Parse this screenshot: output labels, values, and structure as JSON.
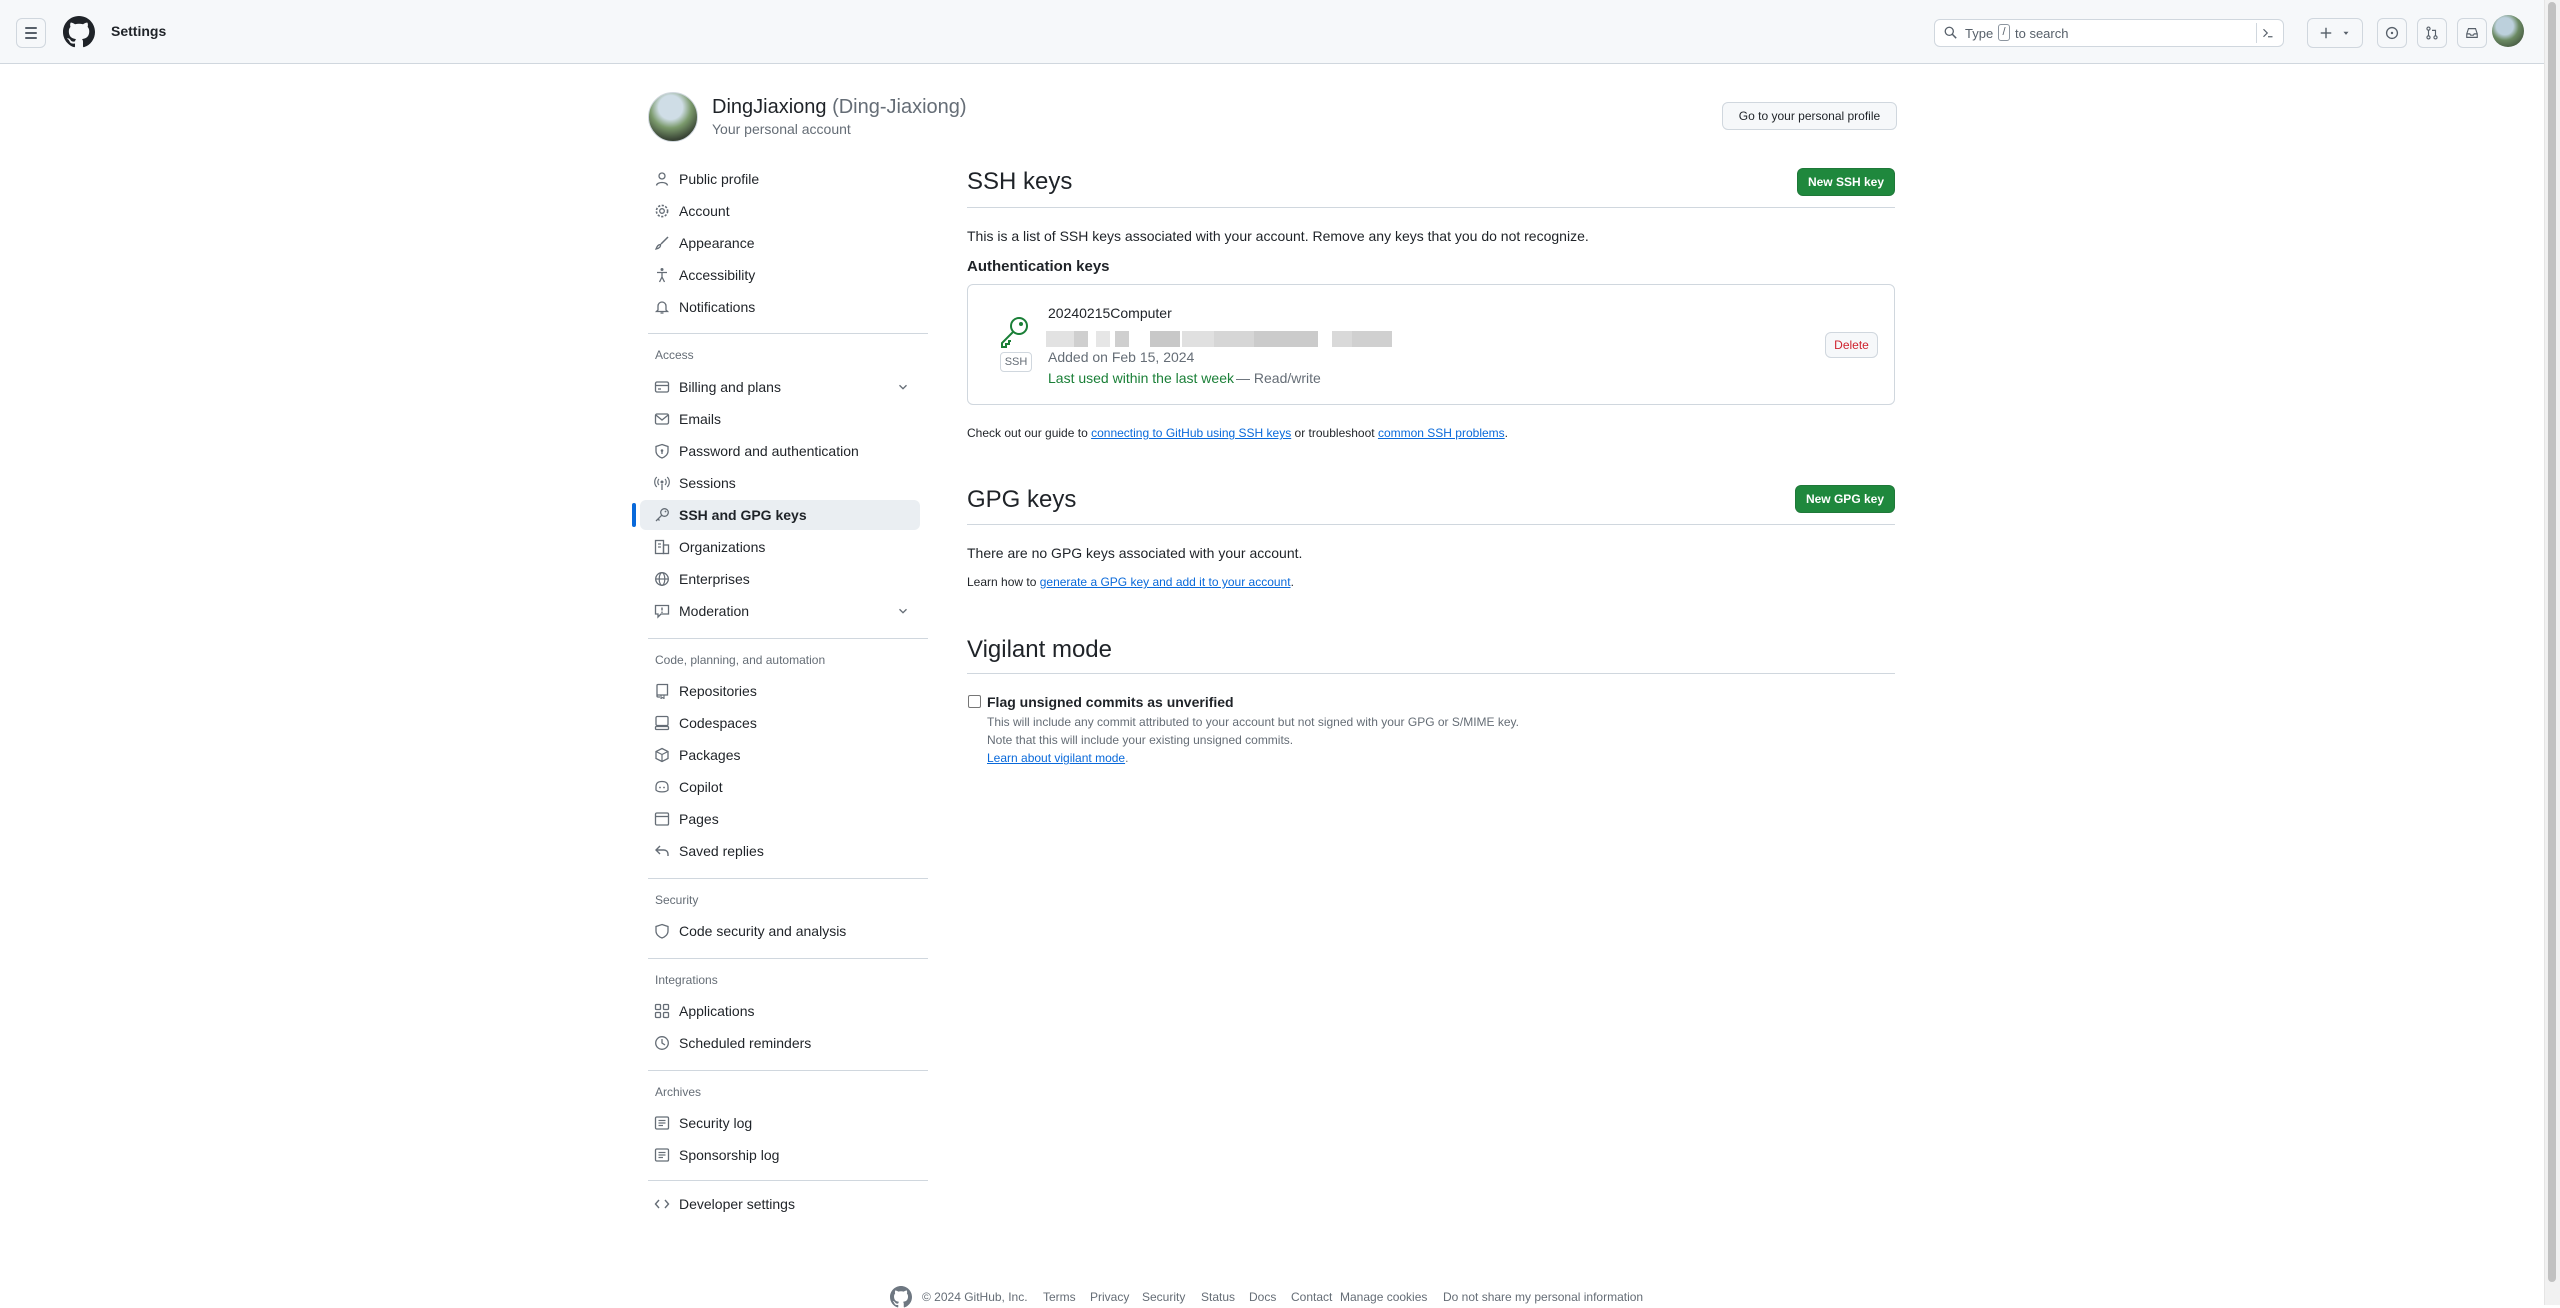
{
  "header": {
    "context": "Settings",
    "search": {
      "prefix": "Type",
      "key": "/",
      "suffix": "to search"
    },
    "icons": [
      "menu-icon",
      "github-mark-icon",
      "search-icon",
      "command-palette-icon",
      "plus-icon",
      "triangle-down-icon",
      "issue-opened-icon",
      "git-pull-request-icon",
      "inbox-icon",
      "avatar"
    ]
  },
  "profile": {
    "name": "DingJiaxiong",
    "login": "(Ding-Jiaxiong)",
    "subtitle": "Your personal account",
    "go_to_profile": "Go to your personal profile"
  },
  "sidebar": {
    "items": [
      {
        "label": "Public profile",
        "icon": "person-icon"
      },
      {
        "label": "Account",
        "icon": "gear-icon"
      },
      {
        "label": "Appearance",
        "icon": "paintbrush-icon"
      },
      {
        "label": "Accessibility",
        "icon": "accessibility-icon"
      },
      {
        "label": "Notifications",
        "icon": "bell-icon"
      }
    ],
    "headings": {
      "access": "Access",
      "code": "Code, planning, and automation",
      "security": "Security",
      "integrations": "Integrations",
      "archives": "Archives"
    },
    "access_items": [
      {
        "label": "Billing and plans",
        "icon": "credit-card-icon",
        "expandable": true
      },
      {
        "label": "Emails",
        "icon": "mail-icon"
      },
      {
        "label": "Password and authentication",
        "icon": "shield-lock-icon"
      },
      {
        "label": "Sessions",
        "icon": "broadcast-icon"
      },
      {
        "label": "SSH and GPG keys",
        "icon": "key-icon",
        "active": true
      },
      {
        "label": "Organizations",
        "icon": "organization-icon"
      },
      {
        "label": "Enterprises",
        "icon": "globe-icon"
      },
      {
        "label": "Moderation",
        "icon": "report-icon",
        "expandable": true
      }
    ],
    "code_items": [
      {
        "label": "Repositories",
        "icon": "repo-icon"
      },
      {
        "label": "Codespaces",
        "icon": "codespaces-icon"
      },
      {
        "label": "Packages",
        "icon": "package-icon"
      },
      {
        "label": "Copilot",
        "icon": "copilot-icon"
      },
      {
        "label": "Pages",
        "icon": "browser-icon"
      },
      {
        "label": "Saved replies",
        "icon": "reply-icon"
      }
    ],
    "security_items": [
      {
        "label": "Code security and analysis",
        "icon": "codescan-icon"
      }
    ],
    "integration_items": [
      {
        "label": "Applications",
        "icon": "apps-icon"
      },
      {
        "label": "Scheduled reminders",
        "icon": "clock-icon"
      }
    ],
    "archive_items": [
      {
        "label": "Security log",
        "icon": "log-icon"
      },
      {
        "label": "Sponsorship log",
        "icon": "log-icon"
      }
    ],
    "developer": {
      "label": "Developer settings",
      "icon": "code-icon"
    }
  },
  "ssh": {
    "title": "SSH keys",
    "new_button": "New SSH key",
    "description": "This is a list of SSH keys associated with your account. Remove any keys that you do not recognize.",
    "auth_heading": "Authentication keys",
    "key": {
      "name": "20240215Computer",
      "badge": "SSH",
      "added": "Added on Feb 15, 2024",
      "last_used": "Last used within the last week",
      "access": "— Read/write",
      "delete": "Delete"
    },
    "guide": {
      "pre": "Check out our guide to",
      "link1": "connecting to GitHub using SSH keys",
      "mid": "or troubleshoot",
      "link2": "common SSH problems",
      "post": "."
    }
  },
  "gpg": {
    "title": "GPG keys",
    "new_button": "New GPG key",
    "empty": "There are no GPG keys associated with your account.",
    "learn_pre": "Learn how to",
    "learn_link": "generate a GPG key and add it to your account",
    "learn_post": "."
  },
  "vigilant": {
    "title": "Vigilant mode",
    "checkbox_label": "Flag unsigned commits as unverified",
    "checked": false,
    "line1": "This will include any commit attributed to your account but not signed with your GPG or S/MIME key.",
    "line2": "Note that this will include your existing unsigned commits.",
    "link": "Learn about vigilant mode",
    "link_post": "."
  },
  "footer": {
    "copyright": "© 2024 GitHub, Inc.",
    "links": [
      "Terms",
      "Privacy",
      "Security",
      "Status",
      "Docs",
      "Contact",
      "Manage cookies",
      "Do not share my personal information"
    ]
  },
  "colors": {
    "accent": "#0969da",
    "green": "#1f883d",
    "danger": "#cf222e",
    "border": "#d0d7de",
    "muted": "#656d76"
  }
}
